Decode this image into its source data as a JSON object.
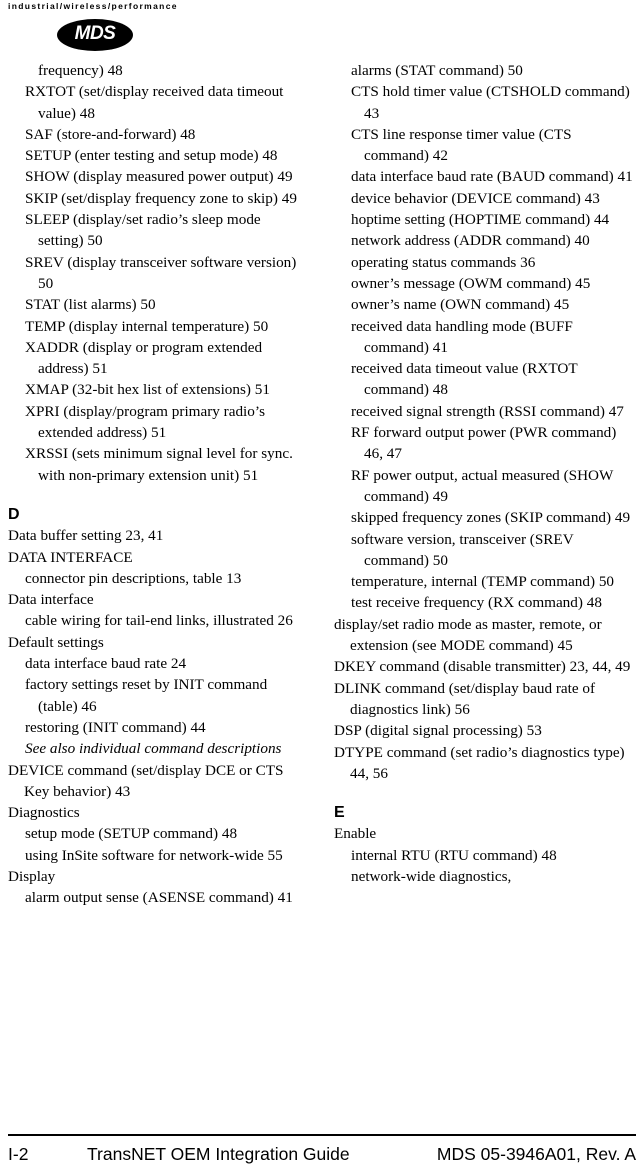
{
  "header": {
    "tagline": "industrial/wireless/performance",
    "logo_text": "MDS"
  },
  "columns": {
    "left": [
      {
        "level": 3,
        "text": "frequency)  48"
      },
      {
        "level": 2,
        "text": "RXTOT (set/display received data timeout value)  48"
      },
      {
        "level": 2,
        "text": "SAF (store-and-forward)  48"
      },
      {
        "level": 2,
        "text": "SETUP (enter testing and setup mode)  48"
      },
      {
        "level": 2,
        "text": "SHOW (display measured power output)  49"
      },
      {
        "level": 2,
        "text": "SKIP (set/display frequency zone to skip)  49"
      },
      {
        "level": 2,
        "text": "SLEEP (display/set radio’s sleep mode setting)  50"
      },
      {
        "level": 2,
        "text": "SREV (display transceiver software version)  50"
      },
      {
        "level": 2,
        "text": "STAT (list alarms)  50"
      },
      {
        "level": 2,
        "text": "TEMP (display internal temperature)  50"
      },
      {
        "level": 2,
        "text": "XADDR (display or program extended address)  51"
      },
      {
        "level": 2,
        "text": "XMAP (32-bit hex list of extensions)  51"
      },
      {
        "level": 2,
        "text": "XPRI (display/program primary radio’s extended address)  51"
      },
      {
        "level": 2,
        "text": "XRSSI (sets minimum signal level for sync. with non-primary extension unit)  51"
      },
      {
        "letter": "D",
        "gap": true
      },
      {
        "level": 1,
        "text": "Data buffer setting  23, 41"
      },
      {
        "level": 1,
        "text": "DATA INTERFACE"
      },
      {
        "level": 2,
        "text": "connector pin descriptions, table  13"
      },
      {
        "level": 1,
        "text": "Data interface"
      },
      {
        "level": 2,
        "text": "cable wiring for tail-end links, illustrated  26"
      },
      {
        "level": 1,
        "text": "Default settings"
      },
      {
        "level": 2,
        "text": "data interface baud rate  24"
      },
      {
        "level": 2,
        "text": "factory settings reset by INIT command (table)  46"
      },
      {
        "level": 2,
        "text": "restoring (INIT command)  44"
      },
      {
        "level": 2,
        "italic": true,
        "text": "See also individual command descriptions"
      },
      {
        "level": 1,
        "text": "DEVICE command (set/display DCE or CTS Key behavior)  43"
      },
      {
        "level": 1,
        "text": "Diagnostics"
      },
      {
        "level": 2,
        "text": "setup mode (SETUP command)  48"
      },
      {
        "level": 2,
        "text": "using InSite software for network-wide  55"
      },
      {
        "level": 1,
        "text": "Display"
      },
      {
        "level": 2,
        "text": "alarm output sense (ASENSE command)  41"
      }
    ],
    "right": [
      {
        "level": 2,
        "text": "alarms (STAT command)  50"
      },
      {
        "level": 2,
        "text": "CTS hold timer value (CTSHOLD command)  43"
      },
      {
        "level": 2,
        "text": "CTS line response timer value (CTS command)  42"
      },
      {
        "level": 2,
        "text": "data interface baud rate (BAUD command)  41"
      },
      {
        "level": 2,
        "text": "device behavior (DEVICE command)  43"
      },
      {
        "level": 2,
        "text": "hoptime setting (HOPTIME command)  44"
      },
      {
        "level": 2,
        "text": "network address (ADDR command)  40"
      },
      {
        "level": 2,
        "text": "operating status commands  36"
      },
      {
        "level": 2,
        "text": "owner’s message (OWM command)  45"
      },
      {
        "level": 2,
        "text": "owner’s name (OWN command)  45"
      },
      {
        "level": 2,
        "text": "received data handling mode (BUFF command)  41"
      },
      {
        "level": 2,
        "text": "received data timeout value (RXTOT command)  48"
      },
      {
        "level": 2,
        "text": "received signal strength (RSSI command)  47"
      },
      {
        "level": 2,
        "text": "RF forward output power (PWR command)  46, 47"
      },
      {
        "level": 2,
        "text": "RF power output, actual measured (SHOW command)  49"
      },
      {
        "level": 2,
        "text": "skipped frequency zones (SKIP command)  49"
      },
      {
        "level": 2,
        "text": "software version, transceiver (SREV command)  50"
      },
      {
        "level": 2,
        "text": "temperature, internal (TEMP command)  50"
      },
      {
        "level": 2,
        "text": "test receive frequency (RX command)  48"
      },
      {
        "level": 1,
        "text": "display/set radio mode as master, remote, or extension (see MODE command)  45"
      },
      {
        "level": 1,
        "text": "DKEY command (disable transmitter)  23, 44, 49"
      },
      {
        "level": 1,
        "text": "DLINK command (set/display baud rate of diagnostics link)  56"
      },
      {
        "level": 1,
        "text": "DSP (digital signal processing)  53"
      },
      {
        "level": 1,
        "text": "DTYPE command (set radio’s diagnostics type)  44, 56"
      },
      {
        "letter": "E",
        "gap": true
      },
      {
        "level": 1,
        "text": "Enable"
      },
      {
        "level": 2,
        "text": "internal RTU (RTU command)  48"
      },
      {
        "level": 2,
        "text": "network-wide diagnostics,"
      }
    ]
  },
  "footer": {
    "page_number": "I-2",
    "title": "TransNET OEM Integration Guide",
    "revision": "MDS 05-3946A01, Rev. A"
  }
}
